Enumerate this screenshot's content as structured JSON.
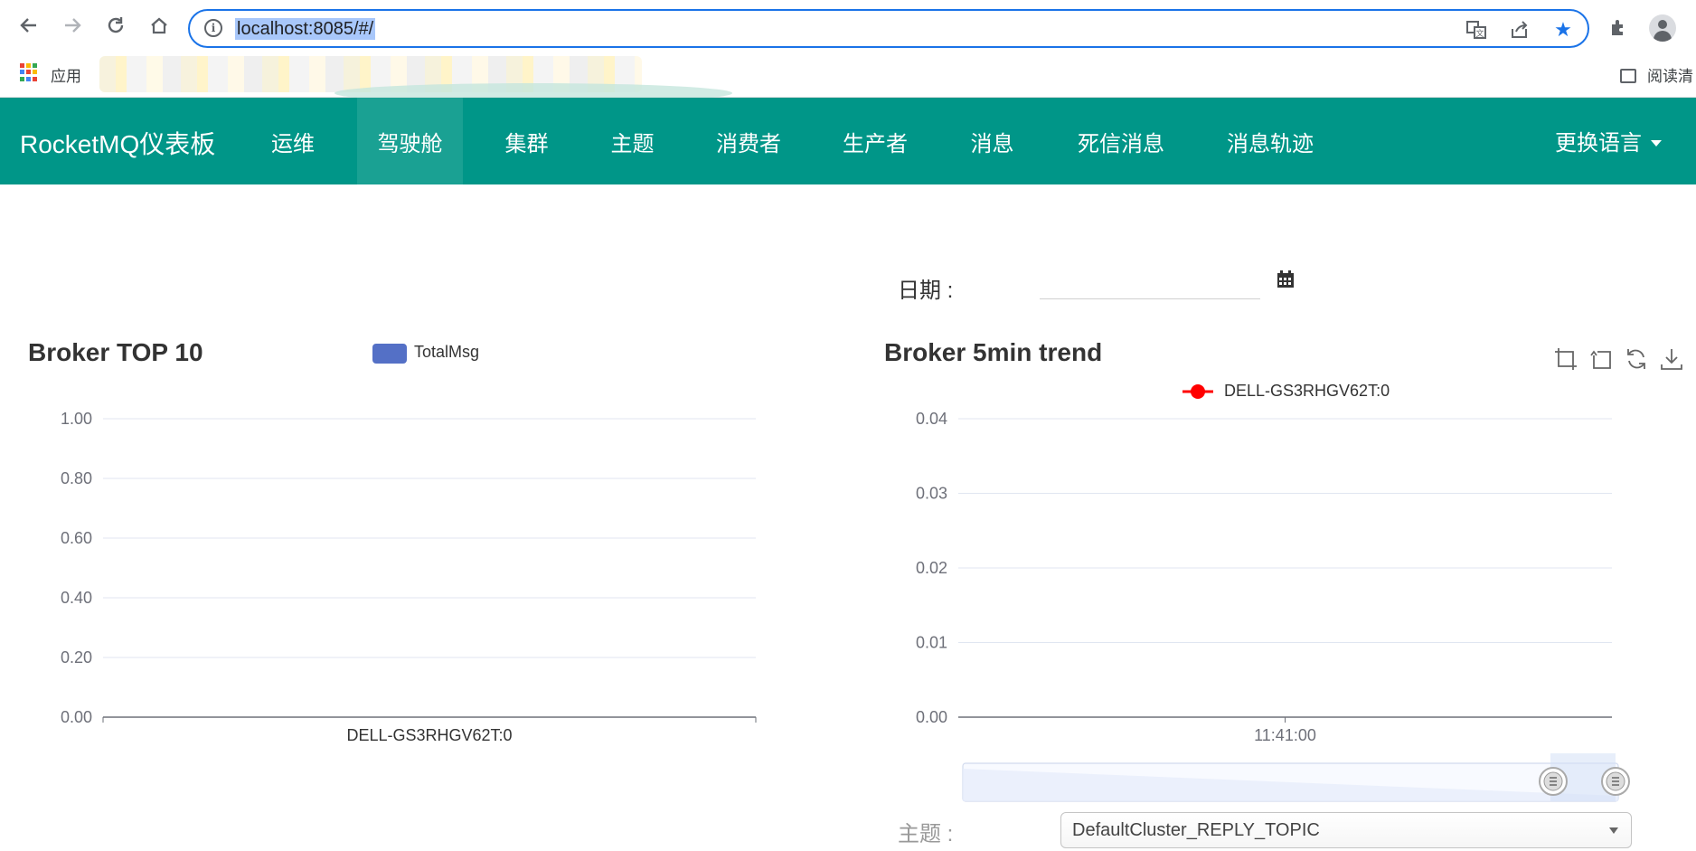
{
  "browser": {
    "url": "localhost:8085/#/",
    "bookmark_apps_label": "应用",
    "reader_mode_label": "阅读清"
  },
  "navbar": {
    "brand": "RocketMQ仪表板",
    "items": [
      {
        "label": "运维"
      },
      {
        "label": "驾驶舱",
        "active": true
      },
      {
        "label": "集群"
      },
      {
        "label": "主题"
      },
      {
        "label": "消费者"
      },
      {
        "label": "生产者"
      },
      {
        "label": "消息"
      },
      {
        "label": "死信消息"
      },
      {
        "label": "消息轨迹"
      }
    ],
    "language": "更换语言"
  },
  "filters": {
    "date_label": "日期 :",
    "date_value": "",
    "topic_label": "主题 :",
    "topic_selected": "DefaultCluster_REPLY_TOPIC"
  },
  "colors": {
    "navbar": "#009688",
    "navbar_active": "#1aa193",
    "bar_series": "#5470c6",
    "line_series": "#ff0000"
  },
  "chart_data": [
    {
      "type": "bar",
      "title": "Broker TOP 10",
      "categories": [
        "DELL-GS3RHGV62T:0"
      ],
      "series": [
        {
          "name": "TotalMsg",
          "values": [
            0
          ]
        }
      ],
      "ylim": [
        0,
        1
      ],
      "yticks": [
        "0.00",
        "0.20",
        "0.40",
        "0.60",
        "0.80",
        "1.00"
      ],
      "grid": true,
      "legend": "top-center"
    },
    {
      "type": "line",
      "title": "Broker 5min trend",
      "x": [
        "11:41:00"
      ],
      "series": [
        {
          "name": "DELL-GS3RHGV62T:0",
          "values": [
            0
          ]
        }
      ],
      "ylim": [
        0,
        0.04
      ],
      "yticks": [
        "0.00",
        "0.01",
        "0.02",
        "0.03",
        "0.04"
      ],
      "grid": true,
      "legend": "top-center",
      "datazoom": true
    }
  ]
}
